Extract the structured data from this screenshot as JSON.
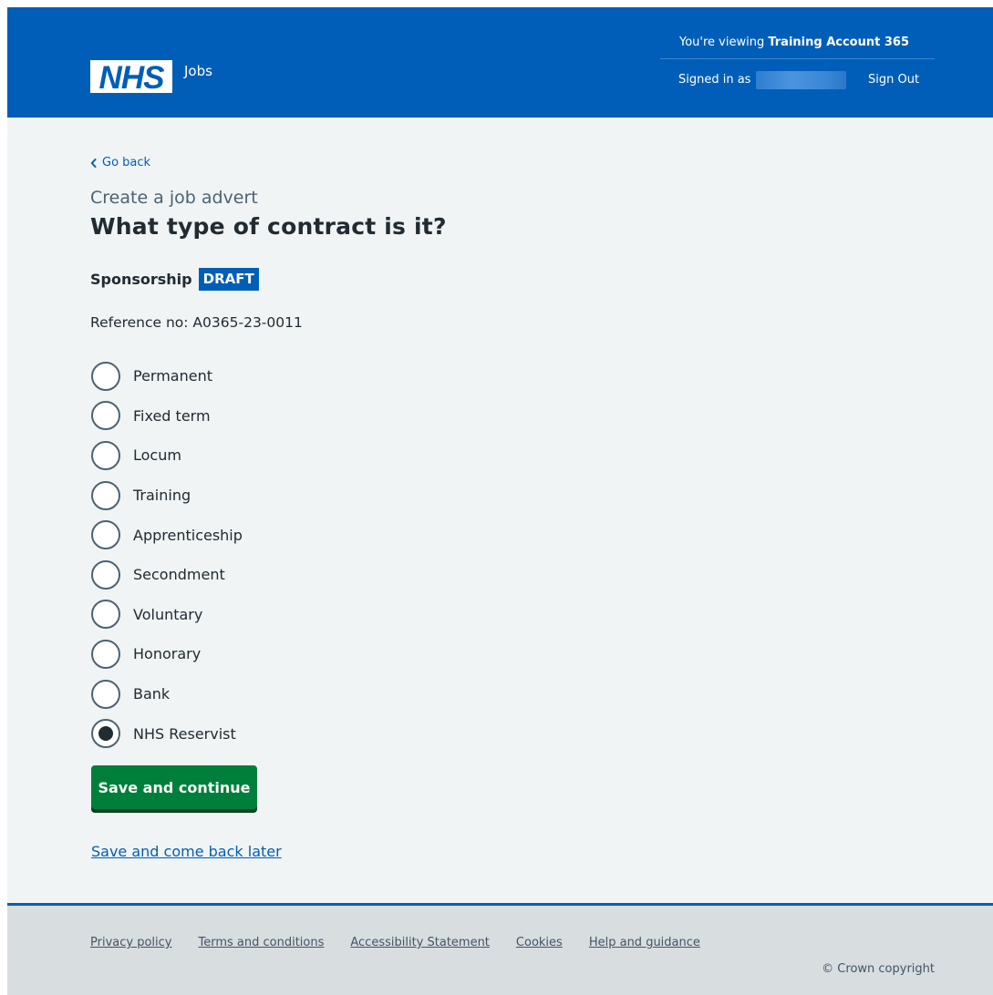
{
  "header": {
    "service_name": "Jobs",
    "logo_text": "NHS",
    "viewing_prefix": "You're viewing ",
    "viewing_account": "Training Account 365",
    "signed_in_label": "Signed in as",
    "sign_out": "Sign Out"
  },
  "back_link": "Go back",
  "caption": "Create a job advert",
  "title": "What type of contract is it?",
  "advert": {
    "name": "Sponsorship",
    "status_tag": "DRAFT",
    "reference": "Reference no: A0365-23-0011"
  },
  "contract_options": [
    {
      "label": "Permanent",
      "selected": false
    },
    {
      "label": "Fixed term",
      "selected": false
    },
    {
      "label": "Locum",
      "selected": false
    },
    {
      "label": "Training",
      "selected": false
    },
    {
      "label": "Apprenticeship",
      "selected": false
    },
    {
      "label": "Secondment",
      "selected": false
    },
    {
      "label": "Voluntary",
      "selected": false
    },
    {
      "label": "Honorary",
      "selected": false
    },
    {
      "label": "Bank",
      "selected": false
    },
    {
      "label": "NHS Reservist",
      "selected": true
    }
  ],
  "save_button": "Save and continue",
  "save_later_link": "Save and come back later",
  "footer": {
    "links": [
      "Privacy policy",
      "Terms and conditions",
      "Accessibility Statement",
      "Cookies",
      "Help and guidance"
    ],
    "copyright": "© Crown copyright"
  },
  "colors": {
    "nhs_blue": "#005eb8",
    "page_background": "#f0f4f5",
    "button_green": "#007f3b",
    "footer_background": "#d8dde0",
    "text": "#212b32"
  }
}
